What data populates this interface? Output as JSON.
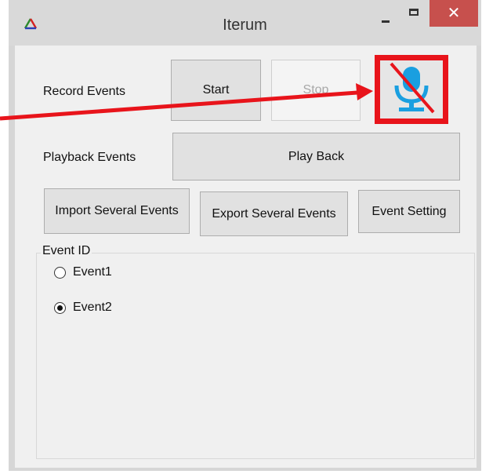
{
  "window": {
    "title": "Iterum",
    "close_glyph": "✕",
    "icons": {
      "app": "triangle-logo-icon",
      "minimize": "minimize-icon",
      "maximize": "maximize-icon",
      "close": "close-icon"
    }
  },
  "record": {
    "label": "Record Events",
    "start_label": "Start",
    "stop_label": "Stop",
    "mic_icon": "microphone-muted-icon"
  },
  "playback": {
    "label": "Playback Events",
    "play_label": "Play Back"
  },
  "toolbar": {
    "import_label": "Import Several Events",
    "export_label": "Export Several Events",
    "setting_label": "Event Setting"
  },
  "event_group": {
    "legend": "Event ID",
    "options": [
      {
        "label": "Event1",
        "checked": false
      },
      {
        "label": "Event2",
        "checked": true
      }
    ]
  },
  "colors": {
    "highlight_red": "#e8141b",
    "close_button": "#c7504d",
    "mic_blue": "#1a9fe0"
  }
}
